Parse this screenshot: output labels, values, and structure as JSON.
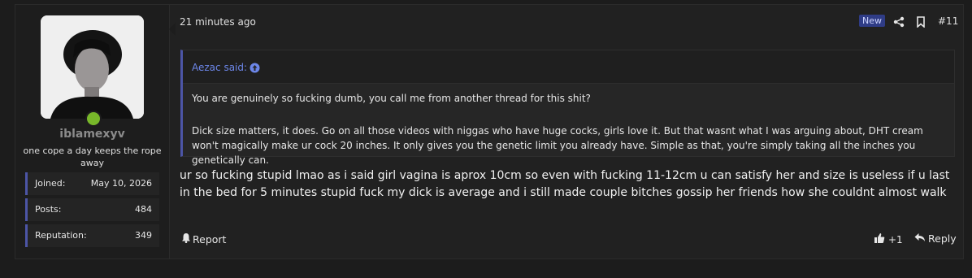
{
  "user": {
    "name": "iblamexyv",
    "title": "one cope a day keeps the rope away",
    "stats": [
      {
        "label": "Joined:",
        "value": "May 10, 2026"
      },
      {
        "label": "Posts:",
        "value": "484"
      },
      {
        "label": "Reputation:",
        "value": "349"
      }
    ]
  },
  "post": {
    "time": "21 minutes ago",
    "badge": "New",
    "number": "#11",
    "quote": {
      "author": "Aezac said:",
      "p1": "You are genuinely so fucking dumb, you call me from another thread for this shit?",
      "p2": "Dick size matters, it does. Go on all those videos with niggas who have huge cocks, girls love it. But that wasnt what I was arguing about, DHT cream won't magically make ur cock 20 inches. It only gives you the genetic limit you already have. Simple as that, you're simply taking all the inches you genetically can."
    },
    "message": "ur so fucking stupid lmao as i said girl vagina is aprox 10cm so even with fucking 11-12cm u can satisfy her and size is useless if u last in the bed for 5 minutes stupid fuck my dick is average and i still made couple bitches gossip her friends how she couldnt almost walk",
    "report_label": "Report",
    "like_count": "+1",
    "reply_label": "Reply"
  },
  "colors": {
    "accent": "#4c55a6",
    "link": "#6c86e8",
    "online": "#78b82a"
  }
}
